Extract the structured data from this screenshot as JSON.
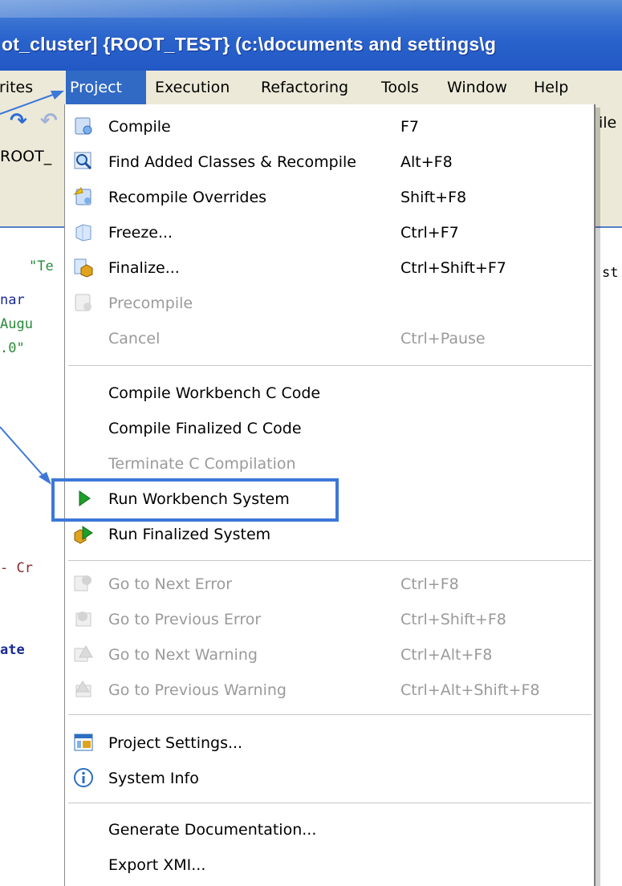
{
  "window": {
    "title": "ot_cluster] {ROOT_TEST} (c:\\documents and settings\\g"
  },
  "menubar": {
    "items": [
      {
        "label": "rites"
      },
      {
        "label": "Project"
      },
      {
        "label": "Execution"
      },
      {
        "label": "Refactoring"
      },
      {
        "label": "Tools"
      },
      {
        "label": "Window"
      },
      {
        "label": "Help"
      }
    ]
  },
  "background": {
    "toolbar_right_text": "ile",
    "tab_text": "ROOT_",
    "code_lines": [
      "\"Te",
      "nar",
      "Augu",
      ".0\"",
      "- Cr",
      "ate"
    ],
    "code_right_text": "st"
  },
  "project_menu": {
    "items": [
      {
        "label": "Compile",
        "shortcut": "F7",
        "icon": "compile-icon",
        "enabled": true
      },
      {
        "label": "Find Added Classes & Recompile",
        "shortcut": "Alt+F8",
        "icon": "find-recompile-icon",
        "enabled": true
      },
      {
        "label": "Recompile Overrides",
        "shortcut": "Shift+F8",
        "icon": "recompile-overrides-icon",
        "enabled": true
      },
      {
        "label": "Freeze...",
        "shortcut": "Ctrl+F7",
        "icon": "freeze-icon",
        "enabled": true
      },
      {
        "label": "Finalize...",
        "shortcut": "Ctrl+Shift+F7",
        "icon": "finalize-icon",
        "enabled": true
      },
      {
        "label": "Precompile",
        "shortcut": "",
        "icon": "precompile-icon",
        "enabled": false
      },
      {
        "label": "Cancel",
        "shortcut": "Ctrl+Pause",
        "icon": "",
        "enabled": false
      },
      {
        "label": "Compile Workbench C Code",
        "shortcut": "",
        "icon": "",
        "enabled": true
      },
      {
        "label": "Compile Finalized C Code",
        "shortcut": "",
        "icon": "",
        "enabled": true
      },
      {
        "label": "Terminate C Compilation",
        "shortcut": "",
        "icon": "",
        "enabled": false
      },
      {
        "label": "Run Workbench System",
        "shortcut": "",
        "icon": "run-workbench-icon",
        "enabled": true
      },
      {
        "label": "Run Finalized System",
        "shortcut": "",
        "icon": "run-finalized-icon",
        "enabled": true
      },
      {
        "label": "Go to Next Error",
        "shortcut": "Ctrl+F8",
        "icon": "next-error-icon",
        "enabled": false
      },
      {
        "label": "Go to Previous Error",
        "shortcut": "Ctrl+Shift+F8",
        "icon": "previous-error-icon",
        "enabled": false
      },
      {
        "label": "Go to Next Warning",
        "shortcut": "Ctrl+Alt+F8",
        "icon": "next-warning-icon",
        "enabled": false
      },
      {
        "label": "Go to Previous Warning",
        "shortcut": "Ctrl+Alt+Shift+F8",
        "icon": "previous-warning-icon",
        "enabled": false
      },
      {
        "label": "Project Settings...",
        "shortcut": "",
        "icon": "project-settings-icon",
        "enabled": true
      },
      {
        "label": "System Info",
        "shortcut": "",
        "icon": "info-icon",
        "enabled": true
      },
      {
        "label": "Generate Documentation...",
        "shortcut": "",
        "icon": "",
        "enabled": true
      },
      {
        "label": "Export XMI...",
        "shortcut": "",
        "icon": "",
        "enabled": true
      }
    ]
  },
  "colors": {
    "titlebar": "#2a63cc",
    "menu_highlight": "#316ac5",
    "annotation": "#3c78d8",
    "disabled_text": "#9a9a9a"
  }
}
